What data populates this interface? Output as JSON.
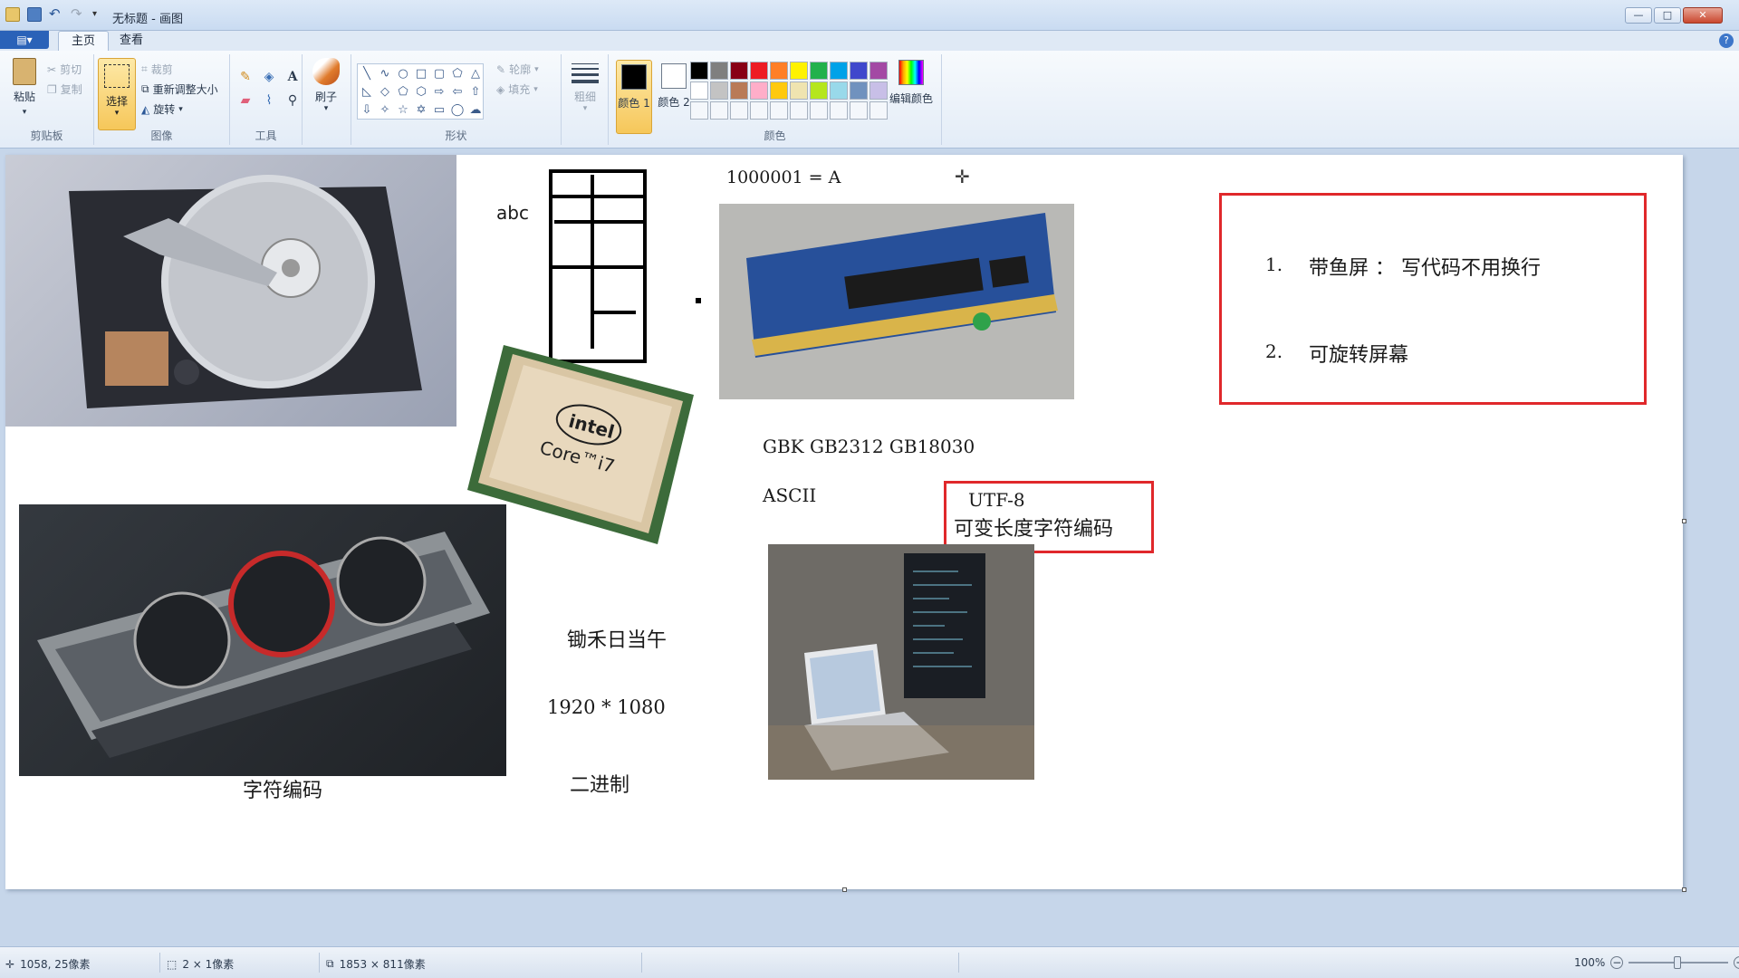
{
  "window": {
    "title": "无标题 - 画图",
    "controls": {
      "minimize": "—",
      "maximize": "□",
      "close": "✕"
    }
  },
  "tabs": {
    "file_label": "▤▾",
    "home": "主页",
    "view": "查看",
    "help": "?"
  },
  "ribbon": {
    "clipboard": {
      "label": "剪贴板",
      "paste": "粘贴",
      "cut": "剪切",
      "copy": "复制"
    },
    "image": {
      "label": "图像",
      "select": "选择",
      "crop": "裁剪",
      "resize": "重新调整大小",
      "rotate": "旋转"
    },
    "tools": {
      "label": "工具"
    },
    "brushes": {
      "label": "刷子"
    },
    "shapes": {
      "label": "形状",
      "outline": "轮廓",
      "fill": "填充"
    },
    "size": {
      "label": "粗细"
    },
    "colors": {
      "label": "颜色",
      "color1": "颜色 1",
      "color2": "颜色 2",
      "edit": "编辑颜色",
      "color1_value": "#000000",
      "color2_value": "#ffffff",
      "palette_row1": [
        "#000000",
        "#7f7f7f",
        "#880015",
        "#ed1c24",
        "#ff7f27",
        "#fff200",
        "#22b14c",
        "#00a2e8",
        "#3f48cc",
        "#a349a4"
      ],
      "palette_row2": [
        "#ffffff",
        "#c3c3c3",
        "#b97a57",
        "#ffaec9",
        "#ffc90e",
        "#efe4b0",
        "#b5e61d",
        "#99d9ea",
        "#7092be",
        "#c8bfe7"
      ]
    }
  },
  "canvas": {
    "texts": {
      "abc": "abc",
      "binary_eq": "1000001 = A",
      "gbk": "GBK GB2312 GB18030",
      "ascii": "ASCII",
      "utf8": "UTF-8",
      "variable_len": "可变长度字符编码",
      "poem": "锄禾日当午",
      "resolution": "1920 * 1080",
      "binary": "二进制",
      "char_encoding": "字符编码"
    },
    "cpu_brand": "intel",
    "cpu_model": "Core™i7",
    "list": [
      {
        "num": "1.",
        "text": "带鱼屏 ： 写代码不用换行"
      },
      {
        "num": "2.",
        "text": "可旋转屏幕"
      }
    ]
  },
  "status": {
    "cursor_pos": "1058, 25像素",
    "selection_size": "2 × 1像素",
    "canvas_size": "1853 × 811像素",
    "zoom": "100%"
  }
}
